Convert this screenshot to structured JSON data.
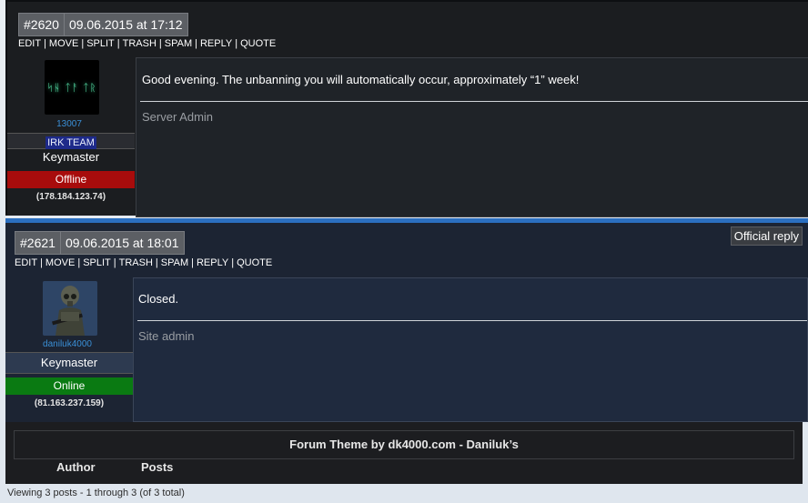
{
  "posts": [
    {
      "number": "#2620",
      "datetime": "09.06.2015 at 17:12",
      "actions": [
        "EDIT",
        "MOVE",
        "SPLIT",
        "TRASH",
        "SPAM",
        "REPLY",
        "QUOTE"
      ],
      "author_id": "13007",
      "team": "IRK TEAM",
      "role": "Keymaster",
      "status": "Offline",
      "ip": "(178.184.123.74)",
      "message": "Good evening. The unbanning you will automatically occur, approximately “1” week!",
      "signature": "Server Admin",
      "avatar_text": "ᛋᚺ ᛏᚨ ᛏᚱ"
    },
    {
      "number": "#2621",
      "datetime": "09.06.2015 at 18:01",
      "official": "Official reply",
      "actions": [
        "EDIT",
        "MOVE",
        "SPLIT",
        "TRASH",
        "SPAM",
        "REPLY",
        "QUOTE"
      ],
      "author_name": "daniluk4000",
      "role": "Keymaster",
      "status": "Online",
      "ip": "(81.163.237.159)",
      "message": "Closed.",
      "signature": "Site admin"
    }
  ],
  "footer": {
    "theme_credit": "Forum Theme by dk4000.com - Daniluk’s",
    "col_author": "Author",
    "col_posts": "Posts"
  },
  "viewing": "Viewing 3 posts - 1 through 3 (of 3 total)",
  "colors": {
    "offline": "#a80c0c",
    "online": "#0a7a12",
    "accent": "#2b6fc0",
    "link": "#3a8fd6"
  }
}
